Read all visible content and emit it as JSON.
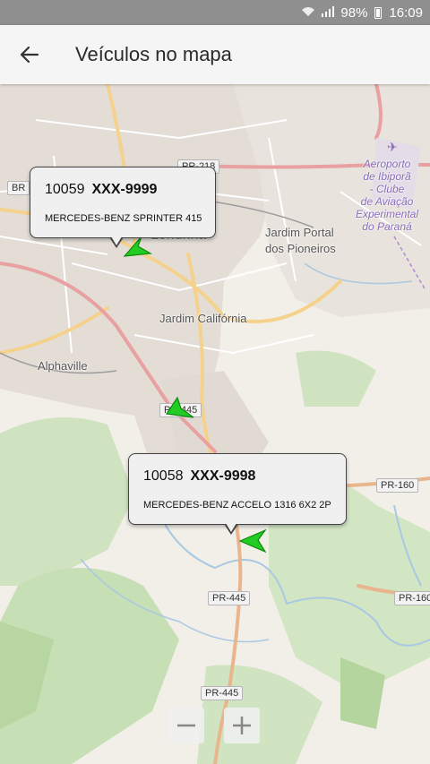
{
  "status_bar": {
    "battery": "98%",
    "time": "16:09"
  },
  "app_bar": {
    "title": "Veículos no mapa"
  },
  "map": {
    "labels": {
      "jardim_portal": "Jardim Portal",
      "dos_pioneiros": "dos Pioneiros",
      "jardim_california": "Jardim Califórnia",
      "alphaville": "Alphaville",
      "londrina": "Londrina",
      "airport_1": "Aeroporto",
      "airport_2": "de Ibiporã",
      "airport_3": "- Clube",
      "airport_4": "de Aviação",
      "airport_5": "Experimental",
      "airport_6": "do Paraná"
    },
    "road_shields": {
      "pr_top": "PR-218",
      "br_left": "BR",
      "pr_445_mid": "PR-445",
      "pr_160_right": "PR-160",
      "pr_160_edge": "PR-160",
      "pr_445_low": "PR-445",
      "pr_445_bottom": "PR-445"
    }
  },
  "vehicles": [
    {
      "id": "10059",
      "plate": "XXX-9999",
      "model": "MERCEDES-BENZ SPRINTER 415"
    },
    {
      "id": "10058",
      "plate": "XXX-9998",
      "model": "MERCEDES-BENZ ACCELO 1316 6X2 2P"
    }
  ],
  "zoom": {
    "out_label": "−",
    "in_label": "+"
  },
  "colors": {
    "marker": "#22cc22",
    "marker_stroke": "#0b8a0b",
    "accent_road": "#e8b58d"
  }
}
